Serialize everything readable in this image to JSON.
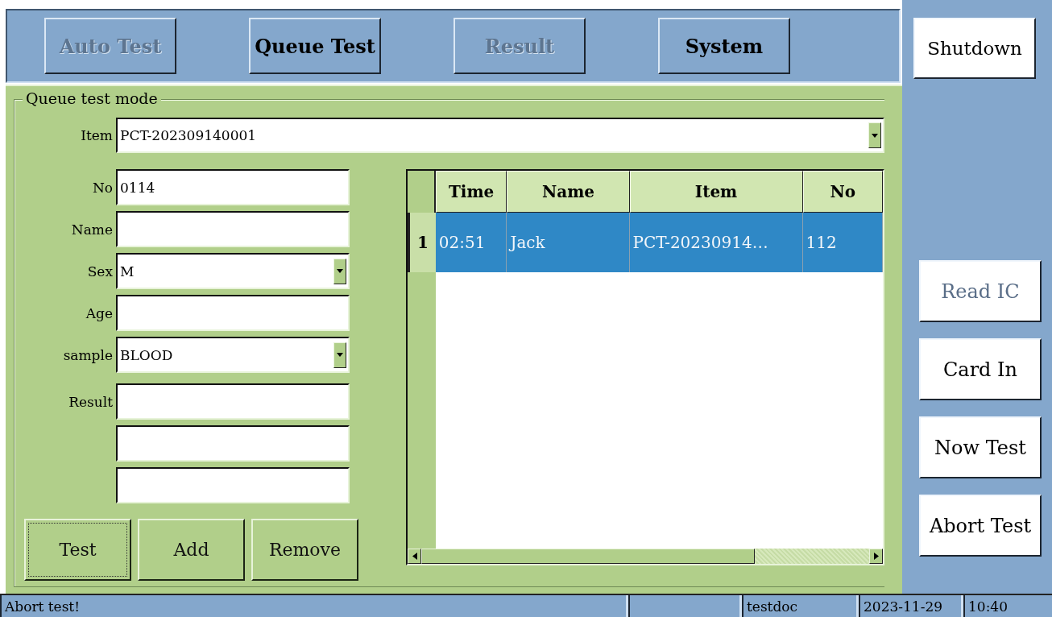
{
  "tabs": [
    {
      "label": "Auto Test",
      "disabled": true
    },
    {
      "label": "Queue Test",
      "disabled": false
    },
    {
      "label": "Result",
      "disabled": true
    },
    {
      "label": "System",
      "disabled": false
    }
  ],
  "side_buttons": [
    {
      "label": "Shutdown",
      "disabled": false
    },
    {
      "label": "Read IC",
      "disabled": true
    },
    {
      "label": "Card In",
      "disabled": false
    },
    {
      "label": "Now Test",
      "disabled": false
    },
    {
      "label": "Abort Test",
      "disabled": false
    }
  ],
  "group_title": "Queue test mode",
  "item_field": {
    "label": "Item",
    "value": "PCT-202309140001"
  },
  "fields": [
    {
      "kind": "text",
      "label": "No",
      "value": "0114"
    },
    {
      "kind": "text",
      "label": "Name"
    },
    {
      "kind": "select",
      "label": "Sex",
      "value": "M"
    },
    {
      "kind": "text",
      "label": "Age"
    },
    {
      "kind": "select",
      "label": "sample",
      "value": "BLOOD"
    },
    {
      "kind": "text",
      "label": "Result"
    },
    {
      "kind": "text"
    },
    {
      "kind": "text"
    }
  ],
  "action_buttons": [
    {
      "label": "Test",
      "focused": true
    },
    {
      "label": "Add",
      "focused": false
    },
    {
      "label": "Remove",
      "focused": false
    }
  ],
  "table": {
    "columns": [
      "Time",
      "Name",
      "Item",
      "No"
    ],
    "rows": [
      {
        "index": "1",
        "selected": true,
        "cells": [
          "02:51",
          "Jack",
          "PCT-20230914…",
          "112"
        ]
      }
    ]
  },
  "status_bar": {
    "message": "Abort test!",
    "user": "testdoc",
    "date": "2023-11-29",
    "time": "10:40"
  }
}
